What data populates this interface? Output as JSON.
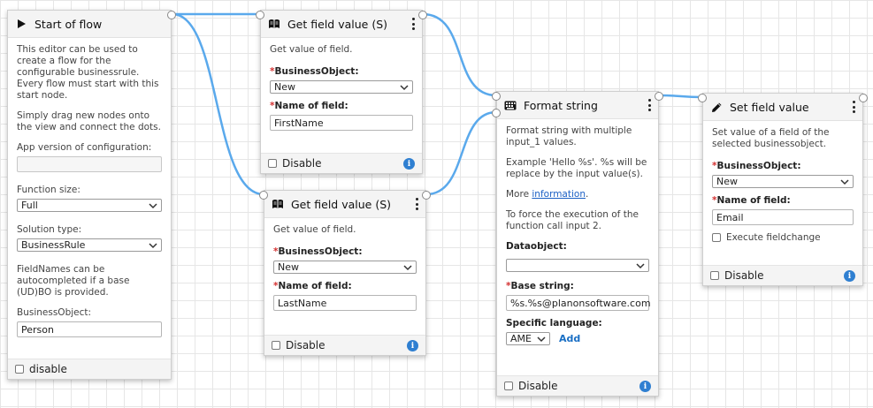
{
  "colors": {
    "wire": "#5aa9ec",
    "info": "#2f7fd1",
    "required": "#d32f2f",
    "link": "#1a5fc4"
  },
  "start_node": {
    "title": "Start of flow",
    "icon": "play-icon",
    "desc1": "This editor can be used to create a flow for the configurable businessrule. Every flow must start with this start node.",
    "desc2": "Simply drag new nodes onto the view and connect the dots.",
    "app_version_label": "App version of configuration:",
    "app_version_value": "",
    "function_size_label": "Function size:",
    "function_size_value": "Full",
    "solution_type_label": "Solution type:",
    "solution_type_value": "BusinessRule",
    "fieldnames_text": "FieldNames can be autocompleted if a base (UD)BO is provided.",
    "business_object_label": "BusinessObject:",
    "business_object_value": "Person",
    "disable_label": "disable"
  },
  "get_field_1": {
    "title": "Get field value (S)",
    "icon": "book-icon",
    "desc": "Get value of field.",
    "bo_label": "BusinessObject:",
    "bo_value": "New",
    "field_label": "Name of field:",
    "field_value": "FirstName",
    "disable_label": "Disable"
  },
  "get_field_2": {
    "title": "Get field value (S)",
    "icon": "book-icon",
    "desc": "Get value of field.",
    "bo_label": "BusinessObject:",
    "bo_value": "New",
    "field_label": "Name of field:",
    "field_value": "LastName",
    "disable_label": "Disable"
  },
  "format_string": {
    "title": "Format string",
    "icon": "keyboard-icon",
    "desc1": "Format string with multiple input_1 values.",
    "desc2": "Example 'Hello %s'. %s will be replace by the input value(s).",
    "more_prefix": "More ",
    "more_link": "information",
    "more_suffix": ".",
    "desc4": "To force the execution of the function call input 2.",
    "dataobject_label": "Dataobject:",
    "dataobject_value": "",
    "base_label": "Base string:",
    "base_value": "%s.%s@planonsoftware.com",
    "lang_label": "Specific language:",
    "lang_value": "AME",
    "add_label": "Add",
    "disable_label": "Disable"
  },
  "set_field": {
    "title": "Set field value",
    "icon": "pencil-icon",
    "desc": "Set value of a field of the selected businessobject.",
    "bo_label": "BusinessObject:",
    "bo_value": "New",
    "field_label": "Name of field:",
    "field_value": "Email",
    "exec_label": "Execute fieldchange",
    "disable_label": "Disable"
  },
  "info_glyph": "i",
  "required_mark": "*"
}
